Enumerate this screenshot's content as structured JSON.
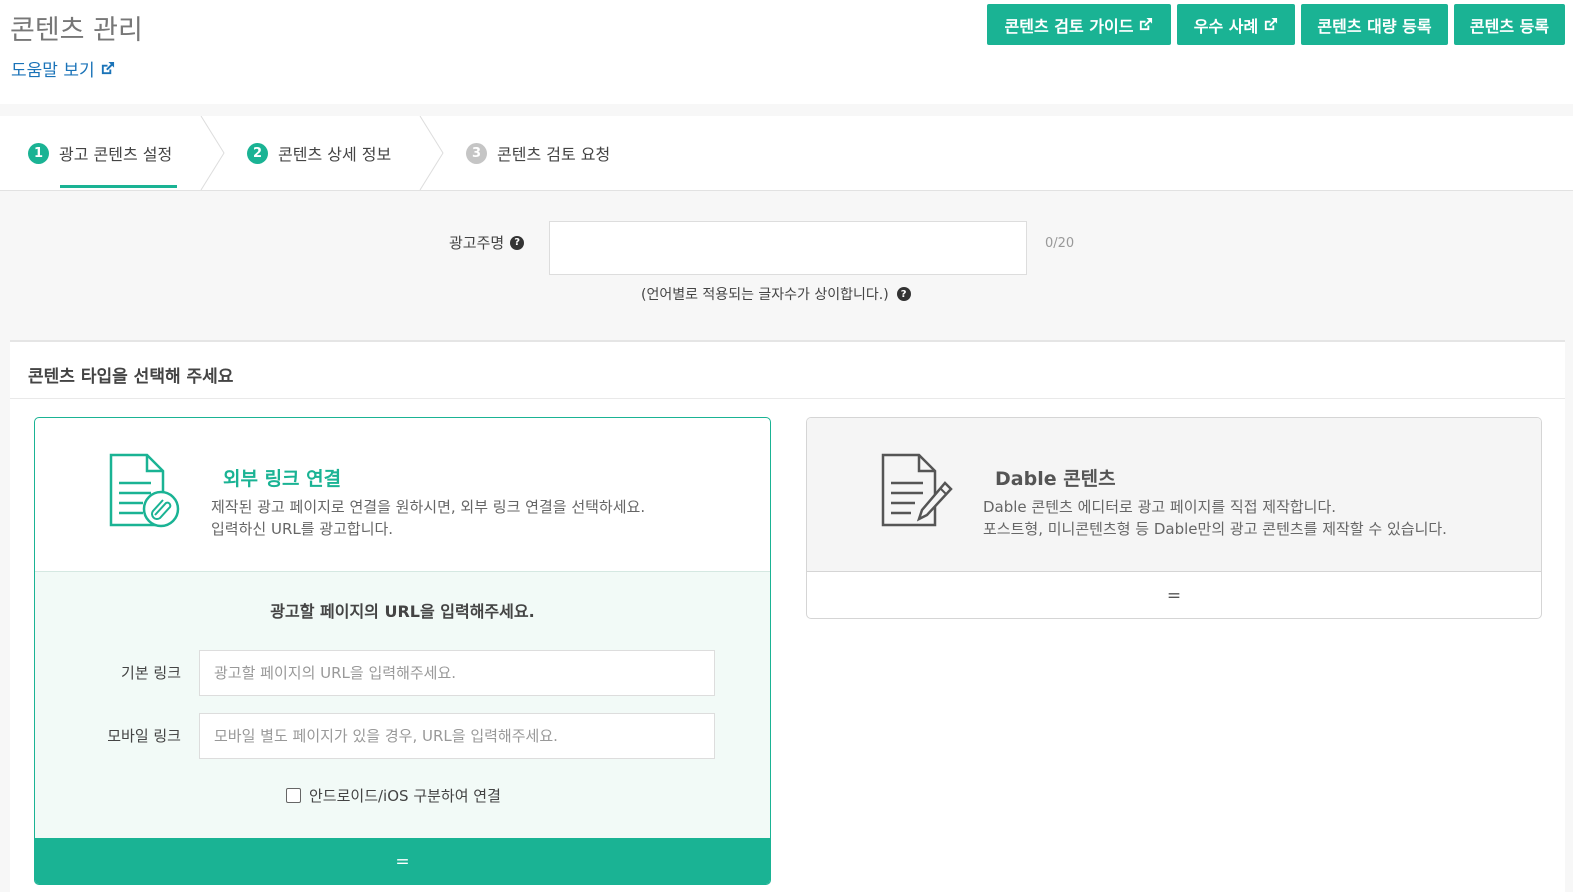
{
  "header": {
    "title": "콘텐츠 관리",
    "help_link": "도움말 보기",
    "buttons": [
      {
        "label": "콘텐츠 검토 가이드"
      },
      {
        "label": "우수 사례"
      },
      {
        "label": "콘텐츠 대량 등록"
      },
      {
        "label": "콘텐츠 등록"
      }
    ]
  },
  "steps": [
    {
      "num": "1",
      "label": "광고 콘텐츠 설정"
    },
    {
      "num": "2",
      "label": "콘텐츠 상세 정보"
    },
    {
      "num": "3",
      "label": "콘텐츠 검토 요청"
    }
  ],
  "advertiser": {
    "label": "광고주명",
    "value": "",
    "counter": "0/20",
    "note": "(언어별로 적용되는 글자수가 상이합니다.)"
  },
  "content_type": {
    "title": "콘텐츠 타입을 선택해 주세요",
    "external": {
      "title": "외부 링크 연결",
      "desc_line1": "제작된 광고 페이지로 연결을 원하시면, 외부 링크 연결을 선택하세요.",
      "desc_line2": "입력하신 URL를 광고합니다.",
      "url_title": "광고할 페이지의 URL을 입력해주세요.",
      "basic_label": "기본 링크",
      "basic_placeholder": "광고할 페이지의 URL을 입력해주세요.",
      "mobile_label": "모바일 링크",
      "mobile_placeholder": "모바일 별도 페이지가 있을 경우, URL을 입력해주세요.",
      "checkbox_label": "안드로이드/iOS 구분하여 연결",
      "footer_symbol": "="
    },
    "dable": {
      "title": "Dable 콘텐츠",
      "desc_line1": "Dable 콘텐츠 에디터로 광고 페이지를 직접 제작합니다.",
      "desc_line2": "포스트형, 미니콘텐츠형 등 Dable만의 광고 콘텐츠를 제작할 수 있습니다.",
      "footer_symbol": "="
    }
  },
  "colors": {
    "accent": "#1ab394",
    "link": "#1a73b8"
  },
  "icons": {
    "external_link": "external-link-icon",
    "help": "question-circle-icon",
    "external_doc": "document-attachment-icon",
    "dable_doc": "document-pencil-icon"
  }
}
